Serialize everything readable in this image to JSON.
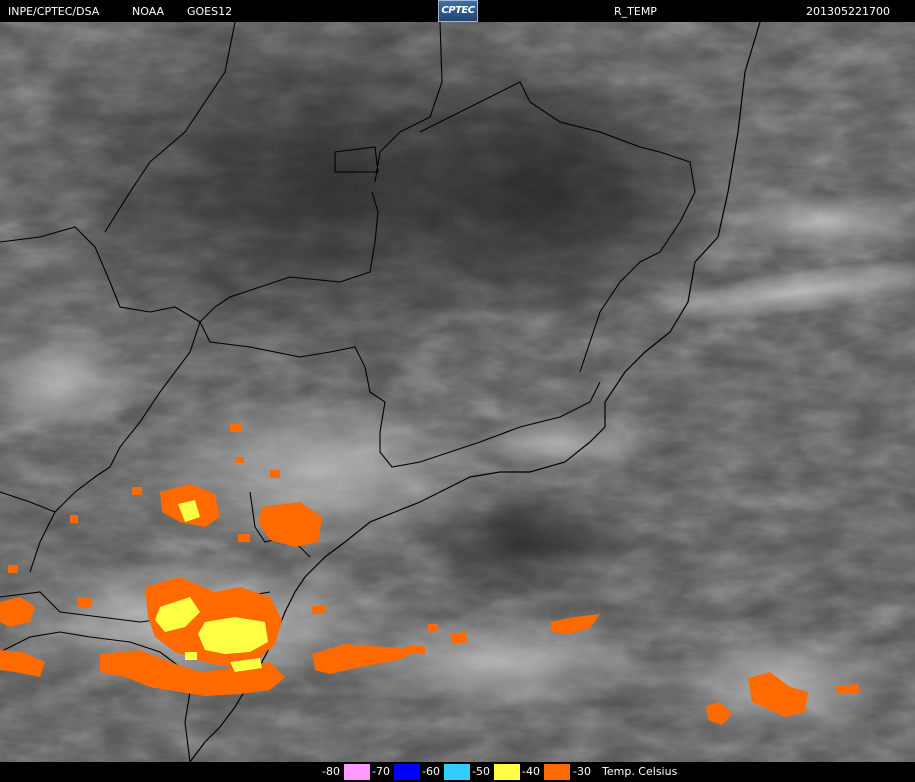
{
  "header": {
    "org": "INPE/CPTEC/DSA",
    "agency": "NOAA",
    "satellite": "GOES12",
    "logo_text": "CPTEC",
    "product": "R_TEMP",
    "datetime": "201305221700"
  },
  "legend": {
    "unit": "Temp. Celsius",
    "items": [
      {
        "label": "-80",
        "color": "#ff99ff"
      },
      {
        "label": "-70",
        "color": "#0000ff"
      },
      {
        "label": "-60",
        "color": "#33ccff"
      },
      {
        "label": "-50",
        "color": "#ffff44"
      },
      {
        "label": "-40",
        "color": "#ff6a00"
      },
      {
        "label": "-30",
        "color": null
      }
    ]
  },
  "colors": {
    "cold_top_orange": "#ff6a00",
    "cold_top_yellow": "#ffff44",
    "background": "#000000",
    "boundaries": "#000000"
  }
}
